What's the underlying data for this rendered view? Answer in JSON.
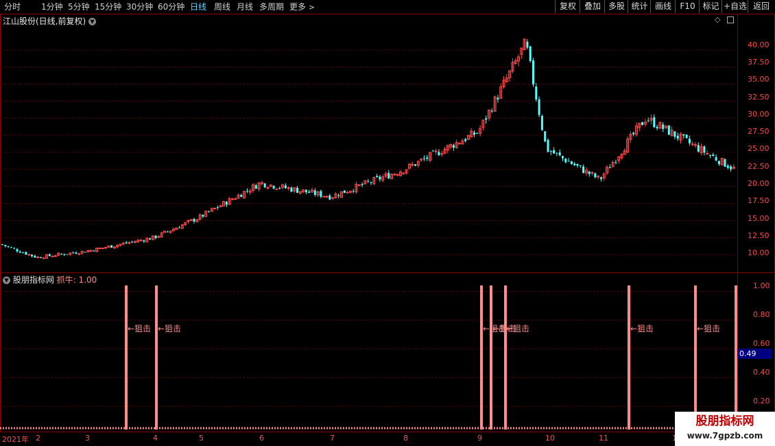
{
  "toolbar": {
    "periods": [
      "分时",
      "1分钟",
      "5分钟",
      "15分钟",
      "30分钟",
      "60分钟",
      "日线",
      "周线",
      "月线",
      "多周期",
      "更多"
    ],
    "active_period": "日线",
    "more_arrow_icon": "chevron-right-icon",
    "buttons": [
      "复权",
      "叠加",
      "多股",
      "统计",
      "画线",
      "F10",
      "标记",
      "+自选",
      "返回"
    ]
  },
  "main_chart": {
    "title": "江山股份(日线,前复权)",
    "collapse_icon": "chevron-down-icon",
    "y_ticks": [
      "40.00",
      "37.50",
      "35.00",
      "32.50",
      "30.00",
      "27.50",
      "25.00",
      "22.50",
      "20.00",
      "17.50",
      "15.00",
      "12.50",
      "10.00"
    ],
    "up_color": "#ff4b4b",
    "down_color": "#54ffff"
  },
  "indicator": {
    "title": "股朋指标网",
    "series_label": "抓牛: 1.00",
    "y_ticks": [
      "1.00",
      "0.80",
      "0.60",
      "0.40",
      "0.20"
    ],
    "current_value": "0.49",
    "signal_label": "←狙击",
    "signal_color": "#ff8c8c"
  },
  "time_axis": {
    "labels": [
      "2021年",
      "2",
      "3",
      "4",
      "5",
      "6",
      "7",
      "8",
      "9",
      "10",
      "11",
      "1"
    ]
  },
  "watermark": {
    "name": "股朋指标网",
    "url": "www.7gpzb.com"
  },
  "chart_data": {
    "type": "candlestick",
    "title": "江山股份(日线,前复权)",
    "ylim": [
      8.5,
      42.5
    ],
    "y_ticks": [
      10,
      12.5,
      15,
      17.5,
      20,
      22.5,
      25,
      27.5,
      30,
      32.5,
      35,
      37.5,
      40
    ],
    "closing_price_path": [
      {
        "month": "2021-01",
        "price": 11.5
      },
      {
        "month": "2021-02",
        "price": 9.6
      },
      {
        "month": "2021-03",
        "price": 10.5
      },
      {
        "month": "2021-04",
        "price": 12.5
      },
      {
        "month": "2021-05",
        "price": 15.5
      },
      {
        "month": "2021-06",
        "price": 20.5
      },
      {
        "month": "2021-07",
        "price": 18.5
      },
      {
        "month": "2021-08",
        "price": 22.5
      },
      {
        "month": "2021-09",
        "price": 28.0
      },
      {
        "month": "2021-09-end",
        "price": 41.0
      },
      {
        "month": "2021-10",
        "price": 25.5
      },
      {
        "month": "2021-11",
        "price": 21.0
      },
      {
        "month": "2021-12",
        "price": 30.0
      },
      {
        "month": "2022-01",
        "price": 22.5
      }
    ],
    "indicator": {
      "name": "抓牛",
      "ylim": [
        0,
        1.05
      ],
      "signals_month_index": [
        3.6,
        4.0,
        9.0,
        9.15,
        9.35,
        11.45,
        12.3,
        12.9
      ],
      "signal_value": 1.0
    }
  }
}
